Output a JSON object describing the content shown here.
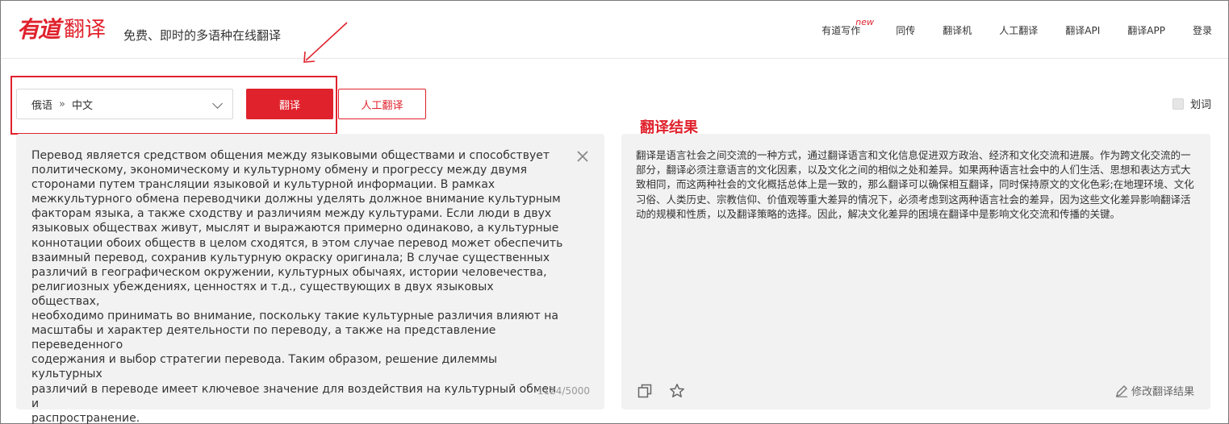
{
  "header": {
    "logo_mark": "有道",
    "logo_word": "翻译",
    "tagline": "免费、即时的多语种在线翻译",
    "nav": [
      {
        "label": "有道写作",
        "badge": "new"
      },
      {
        "label": "同传"
      },
      {
        "label": "翻译机"
      },
      {
        "label": "人工翻译"
      },
      {
        "label": "翻译API"
      },
      {
        "label": "翻译APP"
      },
      {
        "label": "登录"
      }
    ]
  },
  "controls": {
    "source_lang": "俄语",
    "separator": "»",
    "target_lang": "中文",
    "translate_button": "翻译",
    "human_button": "人工翻译",
    "word_select_label": "划词"
  },
  "result_label": "翻译结果",
  "source": {
    "text": "Перевод является средством общения между языковыми обществами и способствует\nполитическому, экономическому и культурному обмену и прогрессу между двумя\nсторонами путем трансляции языковой и культурной информации. В рамках\nмежкультурного обмена переводчики должны уделять должное внимание культурным\nфакторам языка, а также сходству и различиям между культурами. Если люди в двух\nязыковых обществах живут, мыслят и выражаются примерно одинаково, а культурные\nконнотации обоих обществ в целом сходятся, в этом случае перевод может обеспечить\nвзаимный перевод, сохранив культурную окраску оригинала; В случае существенных\nразличий в географическом окружении, культурных обычаях, истории человечества,\nрелигиозных убеждениях, ценностях и т.д., существующих в двух языковых обществах,\nнеобходимо принимать во внимание, поскольку такие культурные различия влияют на\nмасштабы и характер деятельности по переводу, а также на представление переведенного\nсодержания и выбор стратегии перевода. Таким образом, решение дилеммы культурных\nразличий в переводе имеет ключевое значение для воздействия на культурный обмен и\nраспространение.",
    "char_count": "1124/5000"
  },
  "result": {
    "text": "翻译是语言社会之间交流的一种方式，通过翻译语言和文化信息促进双方政治、经济和文化交流和进展。作为跨文化交流的一部分，翻译必须注意语言的文化因素，以及文化之间的相似之处和差异。如果两种语言社会中的人们生活、思想和表达方式大致相同，而这两种社会的文化概括总体上是一致的，那么翻译可以确保相互翻译，同时保持原文的文化色彩;在地理环境、文化习俗、人类历史、宗教信仰、价值观等重大差异的情况下，必须考虑到这两种语言社会的差异，因为这些文化差异影响翻译活动的规模和性质，以及翻译策略的选择。因此，解决文化差异的困境在翻译中是影响文化交流和传播的关键。",
    "edit_label": "修改翻译结果"
  },
  "colors": {
    "brand_red": "#e0222d",
    "panel_bg": "#f2f2f2"
  }
}
